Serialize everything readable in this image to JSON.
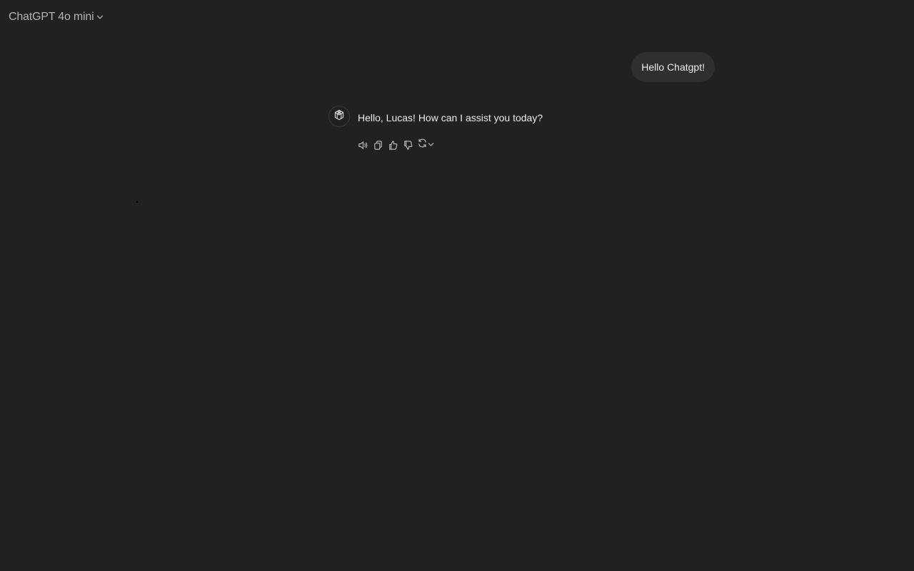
{
  "header": {
    "model_label": "ChatGPT 4o mini",
    "model_dropdown_icon": "chevron-down-icon"
  },
  "conversation": {
    "user_message": "Hello Chatgpt!",
    "assistant_avatar_icon": "openai-logo-icon",
    "assistant_message": "Hello, Lucas! How can I assist you today?",
    "actions": [
      {
        "name": "read-aloud",
        "icon": "speaker-icon"
      },
      {
        "name": "copy",
        "icon": "copy-icon"
      },
      {
        "name": "good-response",
        "icon": "thumbs-up-icon"
      },
      {
        "name": "bad-response",
        "icon": "thumbs-down-icon"
      },
      {
        "name": "regenerate",
        "icon": "refresh-icon"
      }
    ]
  },
  "colors": {
    "background": "#212121",
    "user_bubble": "#2f2f2f",
    "text": "#ececec",
    "muted": "#b4b4b4"
  }
}
